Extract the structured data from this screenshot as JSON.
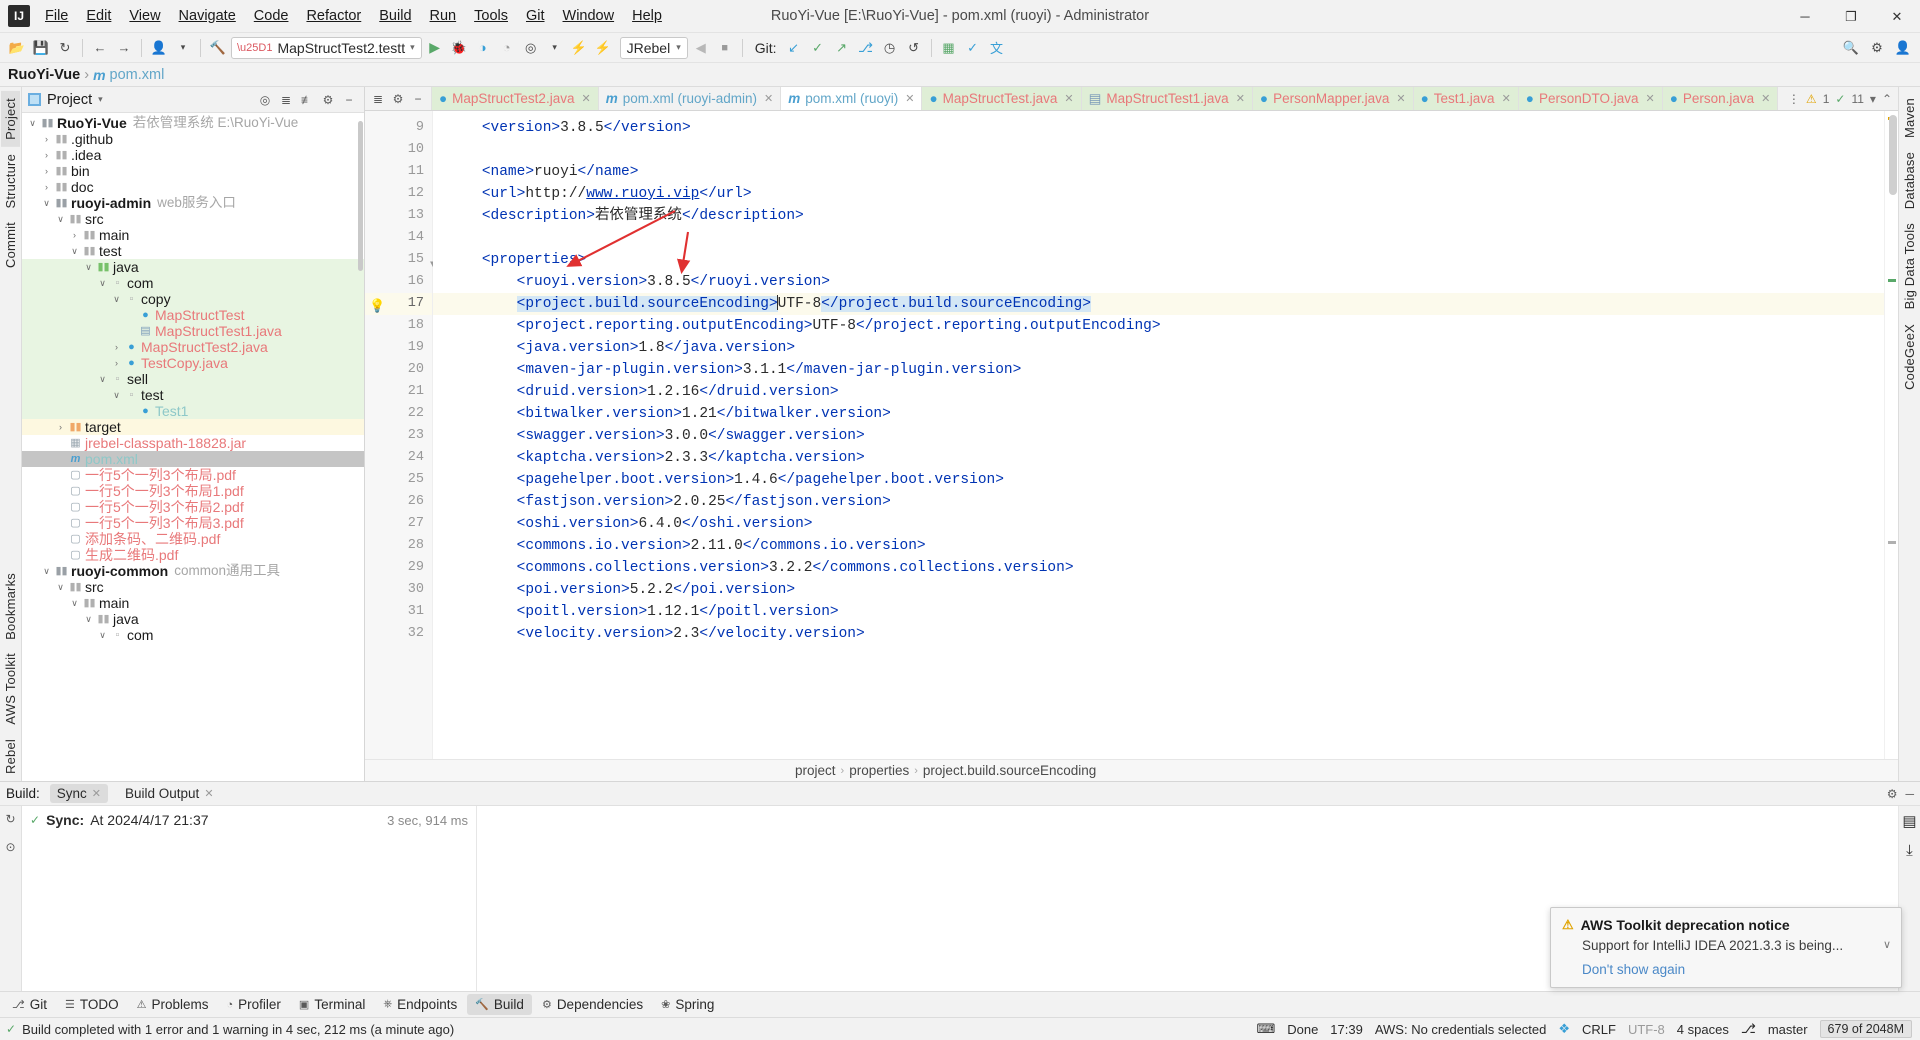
{
  "window": {
    "title": "RuoYi-Vue [E:\\RuoYi-Vue] - pom.xml (ruoyi) - Administrator",
    "minimize": "─",
    "maximize": "❐",
    "close": "✕",
    "logo": "IJ"
  },
  "menu": [
    {
      "label": "File"
    },
    {
      "label": "Edit"
    },
    {
      "label": "View"
    },
    {
      "label": "Navigate"
    },
    {
      "label": "Code"
    },
    {
      "label": "Refactor"
    },
    {
      "label": "Build"
    },
    {
      "label": "Run"
    },
    {
      "label": "Tools"
    },
    {
      "label": "Git"
    },
    {
      "label": "Window"
    },
    {
      "label": "Help"
    }
  ],
  "toolbar": {
    "open_icon": "📂",
    "save_icon": "💾",
    "sync_icon": "↻",
    "back_icon": "←",
    "forward_icon": "→",
    "profile_icon": "👤",
    "profile_caret": "▾",
    "build_icon": "🔨",
    "run_config": "MapStructTest2.testt",
    "run_config_caret": "▾",
    "run_icon": "▶",
    "debug_icon": "🐞",
    "run_coverage_icon": "◑",
    "profiler_icon": "◔",
    "attach_icon": "◎",
    "attach_caret": "▾",
    "jrebel_run_icon": "⚡",
    "jrebel_debug_icon": "⚡",
    "jrebel_label": "JRebel",
    "jrebel_caret": "▾",
    "stop_icon": "■",
    "hammer_icon": "◀",
    "git_label": "Git:",
    "git_update_icon": "↙",
    "git_commit_icon": "✓",
    "git_push_icon": "↗",
    "git_branch_icon": "⎇",
    "git_history_icon": "◷",
    "git_rollback_icon": "↺",
    "chart_icon": "▦",
    "check_circle_icon": "✓",
    "translate_icon": "文",
    "search_icon": "🔍",
    "settings_icon": "⚙",
    "account_icon": "👤"
  },
  "navbar": {
    "project": "RuoYi-Vue",
    "separator": "›",
    "file_icon": "m",
    "file": "pom.xml"
  },
  "left_rail": [
    {
      "label": "Project",
      "active": true
    },
    {
      "label": "Structure",
      "active": false
    },
    {
      "label": "Commit",
      "active": false
    },
    {
      "label": "Bookmarks",
      "active": false
    },
    {
      "label": "AWS Toolkit",
      "active": false
    },
    {
      "label": "Rebel",
      "active": false
    }
  ],
  "right_rail": [
    {
      "label": "Maven"
    },
    {
      "label": "Database"
    },
    {
      "label": "Big Data Tools"
    },
    {
      "label": "CodeGeeX"
    }
  ],
  "project_panel": {
    "title": "Project",
    "title_caret": "▾",
    "actions": [
      "target-icon",
      "expand-all-icon",
      "collapse-all-icon",
      "gear-icon",
      "hide-icon"
    ],
    "tree": [
      {
        "depth": 0,
        "arrow": "∨",
        "icon": "module",
        "label": "RuoYi-Vue",
        "bold": true,
        "sub": "若依管理系统   E:\\RuoYi-Vue",
        "color": "dark",
        "bg": "none"
      },
      {
        "depth": 1,
        "arrow": "›",
        "icon": "folder",
        "label": ".github",
        "color": "dark",
        "bg": "none"
      },
      {
        "depth": 1,
        "arrow": "›",
        "icon": "folder",
        "label": ".idea",
        "color": "dark",
        "bg": "none"
      },
      {
        "depth": 1,
        "arrow": "›",
        "icon": "folder",
        "label": "bin",
        "color": "dark",
        "bg": "none"
      },
      {
        "depth": 1,
        "arrow": "›",
        "icon": "folder",
        "label": "doc",
        "color": "dark",
        "bg": "none"
      },
      {
        "depth": 1,
        "arrow": "∨",
        "icon": "module",
        "label": "ruoyi-admin",
        "bold": true,
        "sub": "web服务入口",
        "color": "dark",
        "bg": "none"
      },
      {
        "depth": 2,
        "arrow": "∨",
        "icon": "folder",
        "label": "src",
        "color": "dark",
        "bg": "none"
      },
      {
        "depth": 3,
        "arrow": "›",
        "icon": "folder",
        "label": "main",
        "color": "dark",
        "bg": "none"
      },
      {
        "depth": 3,
        "arrow": "∨",
        "icon": "folder",
        "label": "test",
        "color": "dark",
        "bg": "none"
      },
      {
        "depth": 4,
        "arrow": "∨",
        "icon": "folder-green",
        "label": "java",
        "color": "dark",
        "bg": "green"
      },
      {
        "depth": 5,
        "arrow": "∨",
        "icon": "package",
        "label": "com",
        "color": "dark",
        "bg": "green"
      },
      {
        "depth": 6,
        "arrow": "∨",
        "icon": "package",
        "label": "copy",
        "color": "dark",
        "bg": "green"
      },
      {
        "depth": 7,
        "arrow": "",
        "icon": "class",
        "label": "MapStructTest",
        "color": "red",
        "bg": "green"
      },
      {
        "depth": 7,
        "arrow": "",
        "icon": "file-java",
        "label": "MapStructTest1.java",
        "color": "red",
        "bg": "green"
      },
      {
        "depth": 6,
        "arrow": "›",
        "icon": "class",
        "label": "MapStructTest2.java",
        "color": "red",
        "bg": "green"
      },
      {
        "depth": 6,
        "arrow": "›",
        "icon": "class",
        "label": "TestCopy.java",
        "color": "red",
        "bg": "green"
      },
      {
        "depth": 5,
        "arrow": "∨",
        "icon": "package",
        "label": "sell",
        "color": "dark",
        "bg": "green"
      },
      {
        "depth": 6,
        "arrow": "∨",
        "icon": "package",
        "label": "test",
        "color": "dark",
        "bg": "green"
      },
      {
        "depth": 7,
        "arrow": "",
        "icon": "class",
        "label": "Test1",
        "color": "teal",
        "bg": "green"
      },
      {
        "depth": 2,
        "arrow": "›",
        "icon": "folder-orange",
        "label": "target",
        "color": "dark",
        "bg": "yellow"
      },
      {
        "depth": 2,
        "arrow": "",
        "icon": "jar",
        "label": "jrebel-classpath-18828.jar",
        "color": "red",
        "bg": "none"
      },
      {
        "depth": 2,
        "arrow": "",
        "icon": "maven",
        "label": "pom.xml",
        "color": "teal",
        "bg": "selected"
      },
      {
        "depth": 2,
        "arrow": "",
        "icon": "pdf",
        "label": "一行5个一列3个布局.pdf",
        "color": "red",
        "bg": "none"
      },
      {
        "depth": 2,
        "arrow": "",
        "icon": "pdf",
        "label": "一行5个一列3个布局1.pdf",
        "color": "red",
        "bg": "none"
      },
      {
        "depth": 2,
        "arrow": "",
        "icon": "pdf",
        "label": "一行5个一列3个布局2.pdf",
        "color": "red",
        "bg": "none"
      },
      {
        "depth": 2,
        "arrow": "",
        "icon": "pdf",
        "label": "一行5个一列3个布局3.pdf",
        "color": "red",
        "bg": "none"
      },
      {
        "depth": 2,
        "arrow": "",
        "icon": "pdf",
        "label": "添加条码、二维码.pdf",
        "color": "red",
        "bg": "none"
      },
      {
        "depth": 2,
        "arrow": "",
        "icon": "pdf",
        "label": "生成二维码.pdf",
        "color": "red",
        "bg": "none"
      },
      {
        "depth": 1,
        "arrow": "∨",
        "icon": "module",
        "label": "ruoyi-common",
        "bold": true,
        "sub": "common通用工具",
        "color": "dark",
        "bg": "none"
      },
      {
        "depth": 2,
        "arrow": "∨",
        "icon": "folder",
        "label": "src",
        "color": "dark",
        "bg": "none"
      },
      {
        "depth": 3,
        "arrow": "∨",
        "icon": "folder",
        "label": "main",
        "color": "dark",
        "bg": "none"
      },
      {
        "depth": 4,
        "arrow": "∨",
        "icon": "folder",
        "label": "java",
        "color": "dark",
        "bg": "none"
      },
      {
        "depth": 5,
        "arrow": "∨",
        "icon": "package",
        "label": "com",
        "color": "dark",
        "bg": "none"
      }
    ]
  },
  "editor_tabs": [
    {
      "label": "MapStructTest2.java",
      "icon": "class",
      "style": "green",
      "close": "✕"
    },
    {
      "label": "pom.xml (ruoyi-admin)",
      "icon": "maven",
      "style": "plain",
      "close": "✕"
    },
    {
      "label": "pom.xml (ruoyi)",
      "icon": "maven",
      "style": "active",
      "close": "✕"
    },
    {
      "label": "MapStructTest.java",
      "icon": "class",
      "style": "green",
      "close": "✕"
    },
    {
      "label": "MapStructTest1.java",
      "icon": "file-java",
      "style": "green",
      "close": "✕"
    },
    {
      "label": "PersonMapper.java",
      "icon": "class",
      "style": "green",
      "close": "✕"
    },
    {
      "label": "Test1.java",
      "icon": "class",
      "style": "green",
      "close": "✕"
    },
    {
      "label": "PersonDTO.java",
      "icon": "class",
      "style": "green",
      "close": "✕"
    },
    {
      "label": "Person.java",
      "icon": "class",
      "style": "green",
      "close": "✕"
    }
  ],
  "editor_tabbar_right": {
    "more_icon": "⋮",
    "warning_count": "1",
    "warning_icon": "⚠",
    "check_count": "11",
    "check_icon": "✓",
    "caret_icon": "▾",
    "collapse_icon": "⌃"
  },
  "editor": {
    "first_line_number": 9,
    "current_line": 17,
    "bulb_icon": "💡",
    "lines": [
      {
        "n": 9,
        "indent": 2,
        "parts": [
          {
            "t": "tag",
            "v": "<version>"
          },
          {
            "t": "txt",
            "v": "3.8.5"
          },
          {
            "t": "tag",
            "v": "</version>"
          }
        ]
      },
      {
        "n": 10,
        "indent": 0,
        "parts": []
      },
      {
        "n": 11,
        "indent": 2,
        "parts": [
          {
            "t": "tag",
            "v": "<name>"
          },
          {
            "t": "txt",
            "v": "ruoyi"
          },
          {
            "t": "tag",
            "v": "</name>"
          }
        ]
      },
      {
        "n": 12,
        "indent": 2,
        "parts": [
          {
            "t": "tag",
            "v": "<url>"
          },
          {
            "t": "txt",
            "v": "http://"
          },
          {
            "t": "lnk",
            "v": "www.ruoyi.vip"
          },
          {
            "t": "tag",
            "v": "</url>"
          }
        ]
      },
      {
        "n": 13,
        "indent": 2,
        "parts": [
          {
            "t": "tag",
            "v": "<description>"
          },
          {
            "t": "txt",
            "v": "若依管理系统"
          },
          {
            "t": "tag",
            "v": "</description>"
          }
        ]
      },
      {
        "n": 14,
        "indent": 0,
        "parts": []
      },
      {
        "n": 15,
        "indent": 2,
        "parts": [
          {
            "t": "tag",
            "v": "<properties>"
          }
        ]
      },
      {
        "n": 16,
        "indent": 4,
        "parts": [
          {
            "t": "tag",
            "v": "<ruoyi.version>"
          },
          {
            "t": "txt",
            "v": "3.8.5"
          },
          {
            "t": "tag",
            "v": "</ruoyi.version>"
          }
        ]
      },
      {
        "n": 17,
        "indent": 4,
        "current": true,
        "parts": [
          {
            "t": "hl-tag",
            "v": "<project.build.sourceEncoding>"
          },
          {
            "t": "caret",
            "v": ""
          },
          {
            "t": "txt",
            "v": "UTF-8"
          },
          {
            "t": "hl-tag",
            "v": "</project.build.sourceEncoding>"
          }
        ]
      },
      {
        "n": 18,
        "indent": 4,
        "parts": [
          {
            "t": "tag",
            "v": "<project.reporting.outputEncoding>"
          },
          {
            "t": "txt",
            "v": "UTF-8"
          },
          {
            "t": "tag",
            "v": "</project.reporting.outputEncoding>"
          }
        ]
      },
      {
        "n": 19,
        "indent": 4,
        "parts": [
          {
            "t": "tag",
            "v": "<java.version>"
          },
          {
            "t": "txt",
            "v": "1.8"
          },
          {
            "t": "tag",
            "v": "</java.version>"
          }
        ]
      },
      {
        "n": 20,
        "indent": 4,
        "parts": [
          {
            "t": "tag",
            "v": "<maven-jar-plugin.version>"
          },
          {
            "t": "txt",
            "v": "3.1.1"
          },
          {
            "t": "tag",
            "v": "</maven-jar-plugin.version>"
          }
        ]
      },
      {
        "n": 21,
        "indent": 4,
        "parts": [
          {
            "t": "tag",
            "v": "<druid.version>"
          },
          {
            "t": "txt",
            "v": "1.2.16"
          },
          {
            "t": "tag",
            "v": "</druid.version>"
          }
        ]
      },
      {
        "n": 22,
        "indent": 4,
        "parts": [
          {
            "t": "tag",
            "v": "<bitwalker.version>"
          },
          {
            "t": "txt",
            "v": "1.21"
          },
          {
            "t": "tag",
            "v": "</bitwalker.version>"
          }
        ]
      },
      {
        "n": 23,
        "indent": 4,
        "parts": [
          {
            "t": "tag",
            "v": "<swagger.version>"
          },
          {
            "t": "txt",
            "v": "3.0.0"
          },
          {
            "t": "tag",
            "v": "</swagger.version>"
          }
        ]
      },
      {
        "n": 24,
        "indent": 4,
        "parts": [
          {
            "t": "tag",
            "v": "<kaptcha.version>"
          },
          {
            "t": "txt",
            "v": "2.3.3"
          },
          {
            "t": "tag",
            "v": "</kaptcha.version>"
          }
        ]
      },
      {
        "n": 25,
        "indent": 4,
        "parts": [
          {
            "t": "tag",
            "v": "<pagehelper.boot.version>"
          },
          {
            "t": "txt",
            "v": "1.4.6"
          },
          {
            "t": "tag",
            "v": "</pagehelper.boot.version>"
          }
        ]
      },
      {
        "n": 26,
        "indent": 4,
        "parts": [
          {
            "t": "tag",
            "v": "<fastjson.version>"
          },
          {
            "t": "txt",
            "v": "2.0.25"
          },
          {
            "t": "tag",
            "v": "</fastjson.version>"
          }
        ]
      },
      {
        "n": 27,
        "indent": 4,
        "parts": [
          {
            "t": "tag",
            "v": "<oshi.version>"
          },
          {
            "t": "txt",
            "v": "6.4.0"
          },
          {
            "t": "tag",
            "v": "</oshi.version>"
          }
        ]
      },
      {
        "n": 28,
        "indent": 4,
        "parts": [
          {
            "t": "tag",
            "v": "<commons.io.version>"
          },
          {
            "t": "txt",
            "v": "2.11.0"
          },
          {
            "t": "tag",
            "v": "</commons.io.version>"
          }
        ]
      },
      {
        "n": 29,
        "indent": 4,
        "parts": [
          {
            "t": "tag",
            "v": "<commons.collections.version>"
          },
          {
            "t": "txt",
            "v": "3.2.2"
          },
          {
            "t": "tag",
            "v": "</commons.collections.version>"
          }
        ]
      },
      {
        "n": 30,
        "indent": 4,
        "parts": [
          {
            "t": "tag",
            "v": "<poi.version>"
          },
          {
            "t": "txt",
            "v": "5.2.2"
          },
          {
            "t": "tag",
            "v": "</poi.version>"
          }
        ]
      },
      {
        "n": 31,
        "indent": 4,
        "parts": [
          {
            "t": "tag",
            "v": "<poitl.version>"
          },
          {
            "t": "txt",
            "v": "1.12.1"
          },
          {
            "t": "tag",
            "v": "</poitl.version>"
          }
        ]
      },
      {
        "n": 32,
        "indent": 4,
        "parts": [
          {
            "t": "tag",
            "v": "<velocity.version>"
          },
          {
            "t": "txt",
            "v": "2.3"
          },
          {
            "t": "tag",
            "v": "</velocity.version>"
          }
        ]
      }
    ]
  },
  "editor_breadcrumb": [
    "project",
    "properties",
    "project.build.sourceEncoding"
  ],
  "build": {
    "title": "Build:",
    "tabs": [
      {
        "label": "Sync",
        "active": true,
        "close": "✕"
      },
      {
        "label": "Build Output",
        "active": false,
        "close": "✕"
      }
    ],
    "gear_icon": "⚙",
    "hide_icon": "─",
    "sync_label": "Sync:",
    "sync_status": "At 2024/4/17 21:37",
    "sync_duration": "3 sec, 914 ms",
    "rail_icons": [
      "↻",
      "⊙"
    ],
    "right_rail_icons": [
      "▤",
      "⤓"
    ]
  },
  "notification": {
    "warn_icon": "⚠",
    "title": "AWS Toolkit deprecation notice",
    "body": "Support for IntelliJ IDEA 2021.3.3 is being...",
    "link": "Don't show again",
    "chevron": "∨"
  },
  "bottom_tabs": [
    {
      "label": "Git",
      "icon": "⎇",
      "active": false
    },
    {
      "label": "TODO",
      "icon": "☰",
      "active": false
    },
    {
      "label": "Problems",
      "icon": "⚠",
      "active": false
    },
    {
      "label": "Profiler",
      "icon": "◔",
      "active": false
    },
    {
      "label": "Terminal",
      "icon": "▣",
      "active": false
    },
    {
      "label": "Endpoints",
      "icon": "⎈",
      "active": false
    },
    {
      "label": "Build",
      "icon": "🔨",
      "active": true
    },
    {
      "label": "Dependencies",
      "icon": "⚙",
      "active": false
    },
    {
      "label": "Spring",
      "icon": "❀",
      "active": false
    }
  ],
  "statusbar": {
    "ok_icon": "✓",
    "message": "Build completed with 1 error and 1 warning in 4 sec, 212 ms (a minute ago)",
    "tools_icon": "⌨",
    "done": "Done",
    "time": "17:39",
    "aws": "AWS: No credentials selected",
    "puzzle_icon": "❖",
    "line_ending": "CRLF",
    "encoding": "UTF-8",
    "indent": "4 spaces",
    "branch_icon": "⎇",
    "branch": "master",
    "memory": "679 of 2048M"
  }
}
